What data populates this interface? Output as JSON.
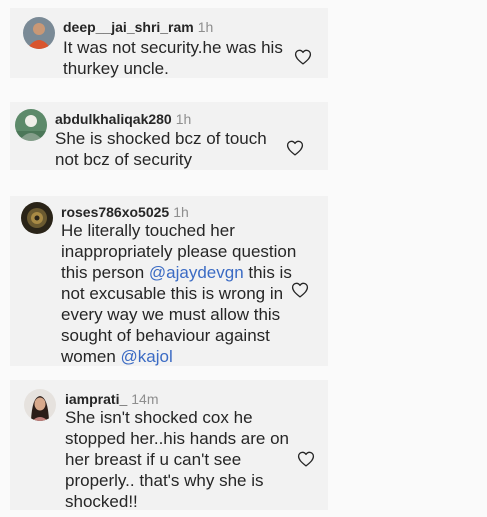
{
  "comments": [
    {
      "username": "deep__jai_shri_ram",
      "time": "1h",
      "lines": [
        [
          {
            "t": "It was not security.he was his"
          }
        ],
        [
          {
            "t": "thurkey uncle."
          }
        ]
      ],
      "like_icon": "heart-outline-icon"
    },
    {
      "username": "abdulkhaliqak280",
      "time": "1h",
      "lines": [
        [
          {
            "t": "She is shocked bcz of touch"
          }
        ],
        [
          {
            "t": "not bcz of security"
          }
        ]
      ],
      "like_icon": "heart-outline-icon"
    },
    {
      "username": "roses786xo5025",
      "time": "1h",
      "lines": [
        [
          {
            "t": "He literally touched her"
          }
        ],
        [
          {
            "t": "inappropriately please question"
          }
        ],
        [
          {
            "t": "this person "
          },
          {
            "t": "@ajaydevgn",
            "m": true
          },
          {
            "t": " this is"
          }
        ],
        [
          {
            "t": "not excusable this is wrong in"
          }
        ],
        [
          {
            "t": "every way we must allow this"
          }
        ],
        [
          {
            "t": "sought of behaviour against"
          }
        ],
        [
          {
            "t": "women "
          },
          {
            "t": "@kajol",
            "m": true
          }
        ]
      ],
      "like_icon": "heart-outline-icon"
    },
    {
      "username": "iamprati_",
      "time": "14m",
      "lines": [
        [
          {
            "t": "She isn't shocked cox he"
          }
        ],
        [
          {
            "t": "stopped her..his hands are on"
          }
        ],
        [
          {
            "t": "her breast if u can't see"
          }
        ],
        [
          {
            "t": "properly.. that's why she is"
          }
        ],
        [
          {
            "t": "shocked!!"
          }
        ]
      ],
      "like_icon": "heart-outline-icon"
    }
  ],
  "colors": {
    "background": "#fafafa",
    "username": "#262626",
    "timestamp": "#8e8e8e",
    "mention": "#3b6bc4"
  }
}
